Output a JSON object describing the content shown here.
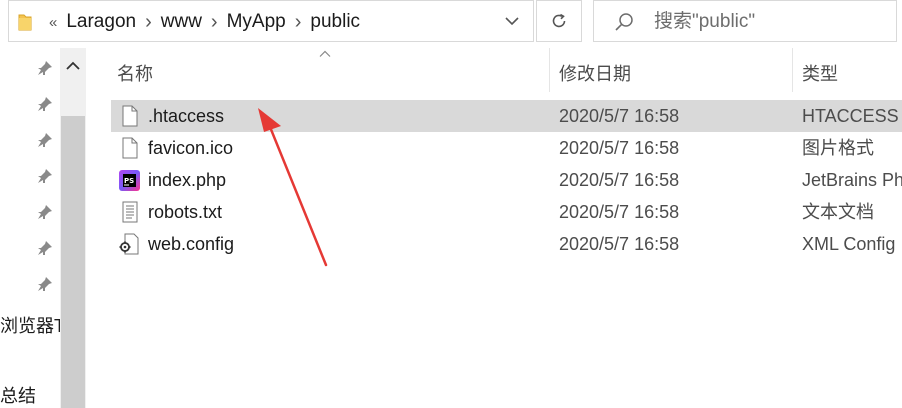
{
  "address_bar": {
    "overflow": "«",
    "crumbs": [
      "Laragon",
      "www",
      "MyApp",
      "public"
    ]
  },
  "search": {
    "placeholder": "搜索\"public\""
  },
  "nav": {
    "labels": [
      "浏览器T",
      "总结"
    ]
  },
  "columns": {
    "name": "名称",
    "date": "修改日期",
    "type": "类型"
  },
  "files": [
    {
      "name": ".htaccess",
      "date": "2020/5/7 16:58",
      "type": "HTACCESS 文",
      "icon": "blank-file-icon",
      "selected": true
    },
    {
      "name": "favicon.ico",
      "date": "2020/5/7 16:58",
      "type": "图片格式",
      "icon": "blank-file-icon",
      "selected": false
    },
    {
      "name": "index.php",
      "date": "2020/5/7 16:58",
      "type": "JetBrains Ph",
      "icon": "phpstorm-file-icon",
      "selected": false
    },
    {
      "name": "robots.txt",
      "date": "2020/5/7 16:58",
      "type": "文本文档",
      "icon": "text-file-icon",
      "selected": false
    },
    {
      "name": "web.config",
      "date": "2020/5/7 16:58",
      "type": "XML Config",
      "icon": "config-file-icon",
      "selected": false
    }
  ],
  "colors": {
    "selection": "#d9d9d9",
    "annotation_arrow": "#e53935",
    "folder": "#f4c34f"
  }
}
